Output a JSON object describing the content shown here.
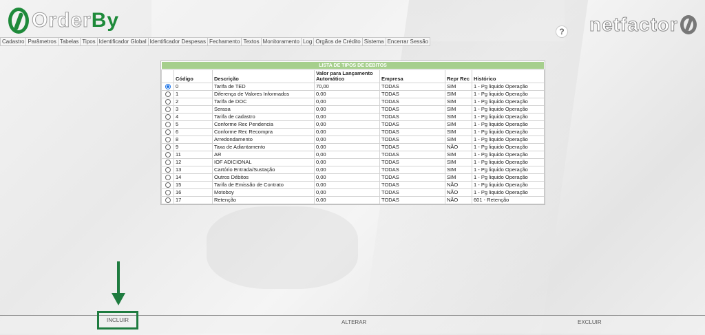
{
  "header": {
    "logo_part1": "Order",
    "logo_part2": "By",
    "brand": "netfactor",
    "help_icon": "?",
    "accent": "#1e8a3a"
  },
  "menu": [
    "Cadastro",
    "Parâmetros",
    "Tabelas",
    "Tipos",
    "Identificador Global",
    "Identificador Despesas",
    "Fechamento",
    "Textos",
    "Monitoramento",
    "Log",
    "Orgãos de Crédito",
    "Sistema",
    "Encerrar Sessão"
  ],
  "list": {
    "title": "LISTA DE TIPOS DE DEBITOS",
    "columns": [
      "Código",
      "Descrição",
      "Valor para Lançamento Automático",
      "Empresa",
      "Repr Rec",
      "Histórico"
    ],
    "rows": [
      {
        "selected": true,
        "codigo": "0",
        "descricao": "Tarifa de TED",
        "valor": "70,00",
        "empresa": "TODAS",
        "repr": "SIM",
        "historico": "1 - Pg liquido Operação"
      },
      {
        "selected": false,
        "codigo": "1",
        "descricao": "Diferença de Valores Informados",
        "valor": "0,00",
        "empresa": "TODAS",
        "repr": "SIM",
        "historico": "1 - Pg liquido Operação"
      },
      {
        "selected": false,
        "codigo": "2",
        "descricao": "Tarifa de DOC",
        "valor": "0,00",
        "empresa": "TODAS",
        "repr": "SIM",
        "historico": "1 - Pg liquido Operação"
      },
      {
        "selected": false,
        "codigo": "3",
        "descricao": "Serasa",
        "valor": "0,00",
        "empresa": "TODAS",
        "repr": "SIM",
        "historico": "1 - Pg liquido Operação"
      },
      {
        "selected": false,
        "codigo": "4",
        "descricao": "Tarifa de cadastro",
        "valor": "0,00",
        "empresa": "TODAS",
        "repr": "SIM",
        "historico": "1 - Pg liquido Operação"
      },
      {
        "selected": false,
        "codigo": "5",
        "descricao": "Conforme Rec Pendencia",
        "valor": "0,00",
        "empresa": "TODAS",
        "repr": "SIM",
        "historico": "1 - Pg liquido Operação"
      },
      {
        "selected": false,
        "codigo": "6",
        "descricao": "Conforme Rec Recompra",
        "valor": "0,00",
        "empresa": "TODAS",
        "repr": "SIM",
        "historico": "1 - Pg liquido Operação"
      },
      {
        "selected": false,
        "codigo": "8",
        "descricao": "Arredondamento",
        "valor": "0,00",
        "empresa": "TODAS",
        "repr": "SIM",
        "historico": "1 - Pg liquido Operação"
      },
      {
        "selected": false,
        "codigo": "9",
        "descricao": "Taxa de Adiantamento",
        "valor": "0,00",
        "empresa": "TODAS",
        "repr": "NÃO",
        "historico": "1 - Pg liquido Operação"
      },
      {
        "selected": false,
        "codigo": "11",
        "descricao": "AR",
        "valor": "0,00",
        "empresa": "TODAS",
        "repr": "SIM",
        "historico": "1 - Pg liquido Operação"
      },
      {
        "selected": false,
        "codigo": "12",
        "descricao": "IOF ADICIONAL",
        "valor": "0,00",
        "empresa": "TODAS",
        "repr": "SIM",
        "historico": "1 - Pg liquido Operação"
      },
      {
        "selected": false,
        "codigo": "13",
        "descricao": "Cartório Entrada/Sustação",
        "valor": "0,00",
        "empresa": "TODAS",
        "repr": "SIM",
        "historico": "1 - Pg liquido Operação"
      },
      {
        "selected": false,
        "codigo": "14",
        "descricao": "Outros Débitos",
        "valor": "0,00",
        "empresa": "TODAS",
        "repr": "SIM",
        "historico": "1 - Pg liquido Operação"
      },
      {
        "selected": false,
        "codigo": "15",
        "descricao": "Tarifa de Emissão de Contrato",
        "valor": "0,00",
        "empresa": "TODAS",
        "repr": "NÃO",
        "historico": "1 - Pg liquido Operação"
      },
      {
        "selected": false,
        "codigo": "16",
        "descricao": "Motoboy",
        "valor": "0,00",
        "empresa": "TODAS",
        "repr": "NÃO",
        "historico": "1 - Pg liquido Operação"
      },
      {
        "selected": false,
        "codigo": "17",
        "descricao": "Retenção",
        "valor": "0,00",
        "empresa": "TODAS",
        "repr": "NÃO",
        "historico": "601 - Retenção"
      }
    ]
  },
  "footer": {
    "incluir": "INCLUIR",
    "alterar": "ALTERAR",
    "excluir": "EXCLUIR",
    "highlight_color": "#1e7b3f"
  }
}
